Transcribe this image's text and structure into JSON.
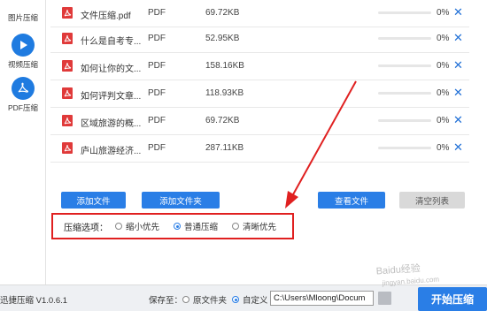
{
  "sidebar": {
    "items": [
      {
        "label": "图片压缩",
        "icon": "image-icon"
      },
      {
        "label": "视频压缩",
        "icon": "play-icon"
      },
      {
        "label": "PDF压缩",
        "icon": "pdf-icon"
      }
    ]
  },
  "files": [
    {
      "name": "文件压缩.pdf",
      "type": "PDF",
      "size": "69.72KB",
      "progress": "0%",
      "progress_fraction": 0
    },
    {
      "name": "什么是自考专...",
      "type": "PDF",
      "size": "52.95KB",
      "progress": "0%",
      "progress_fraction": 0
    },
    {
      "name": "如何让你的文...",
      "type": "PDF",
      "size": "158.16KB",
      "progress": "0%",
      "progress_fraction": 0
    },
    {
      "name": "如何评判文章...",
      "type": "PDF",
      "size": "118.93KB",
      "progress": "0%",
      "progress_fraction": 0
    },
    {
      "name": "区域旅游的概...",
      "type": "PDF",
      "size": "69.72KB",
      "progress": "0%",
      "progress_fraction": 0
    },
    {
      "name": "庐山旅游经济...",
      "type": "PDF",
      "size": "287.11KB",
      "progress": "0%",
      "progress_fraction": 0
    }
  ],
  "delete_glyph": "✕",
  "buttons": {
    "add_file": "添加文件",
    "add_folder": "添加文件夹",
    "view_file": "查看文件",
    "clear_list": "清空列表"
  },
  "options": {
    "label": "压缩选项：",
    "choices": [
      "缩小优先",
      "普通压缩",
      "清晰优先"
    ],
    "selected": "普通压缩"
  },
  "footer": {
    "version": "迅捷压缩 V1.0.6.1",
    "save_to": "保存至：",
    "original_folder": "原文件夹",
    "custom": "自定义",
    "selected_save": "自定义",
    "path": "C:\\Users\\Mloong\\Docum",
    "start": "开始压缩"
  },
  "watermark": {
    "text": "Baidu经验",
    "sub": "jingyan.baidu.com"
  },
  "colors": {
    "accent": "#2a7ee6",
    "highlight_box": "#e02020",
    "pdf_icon": "#e03a3a"
  }
}
